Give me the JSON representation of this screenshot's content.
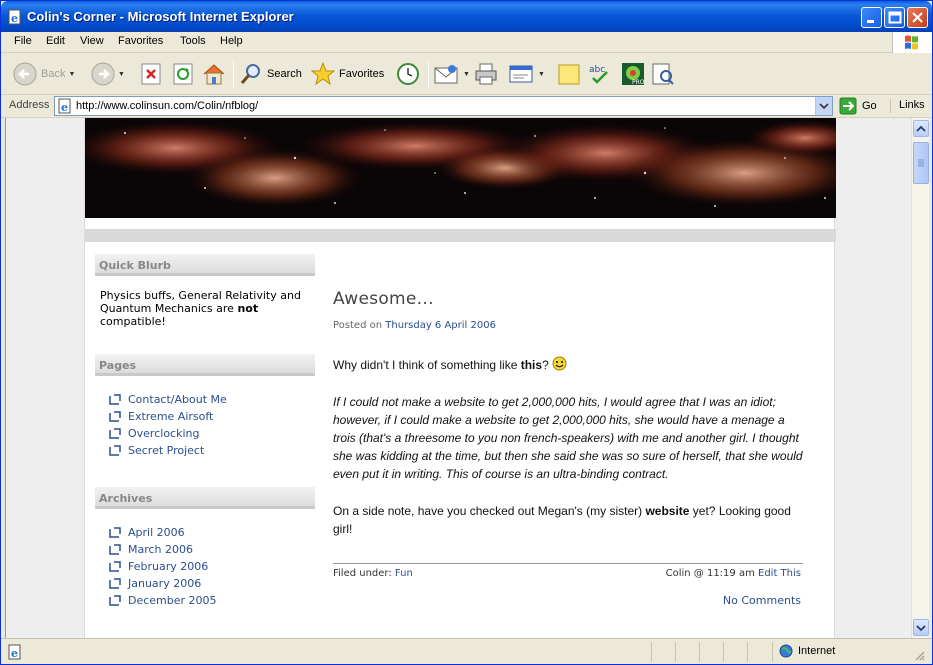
{
  "window": {
    "title": "Colin's Corner - Microsoft Internet Explorer"
  },
  "menu": [
    "File",
    "Edit",
    "View",
    "Favorites",
    "Tools",
    "Help"
  ],
  "toolbar": {
    "back_label": "Back",
    "search_label": "Search",
    "favorites_label": "Favorites"
  },
  "address": {
    "label": "Address",
    "url": "http://www.colinsun.com/Colin/nfblog/",
    "go_label": "Go",
    "links_label": "Links"
  },
  "sidebar": {
    "blurb_heading": "Quick Blurb",
    "blurb_pre": "Physics buffs, General Relativity and Quantum Mechanics are ",
    "blurb_bold": "not",
    "blurb_post": " compatible!",
    "pages_heading": "Pages",
    "pages": [
      "Contact/About Me",
      "Extreme Airsoft",
      "Overclocking",
      "Secret Project"
    ],
    "archives_heading": "Archives",
    "archives": [
      "April 2006",
      "March 2006",
      "February 2006",
      "January 2006",
      "December 2005"
    ]
  },
  "post": {
    "title": "Awesome...",
    "posted_prefix": "Posted on ",
    "date": "Thursday 6 April 2006",
    "intro_pre": "Why didn't I think of something like ",
    "intro_bold": "this",
    "intro_post": "?",
    "quote": "If I could not make a website to get 2,000,000 hits, I would agree that I was an idiot; however, if I could make a website to get 2,000,000 hits, she would have a menage a trois (that's a threesome to you non french-speakers) with me and another girl. I thought she was kidding at the time, but then she said she was so sure of herself, that she would even put it in writing.   This of course is an ultra-binding contract.",
    "side_note_pre": "On a side note, have you checked out Megan's (my sister) ",
    "side_note_bold": "website",
    "side_note_post": " yet? Looking good girl!",
    "filed_prefix": "Filed under: ",
    "category": "Fun",
    "author_text": "Colin @ 11:19 am ",
    "edit_label": "Edit This",
    "comments_label": "No Comments"
  },
  "status": {
    "zone_label": "Internet"
  },
  "colors": {
    "titlebar": "#0a58d6",
    "link": "#2a4f8f",
    "chrome": "#ece9d8"
  }
}
